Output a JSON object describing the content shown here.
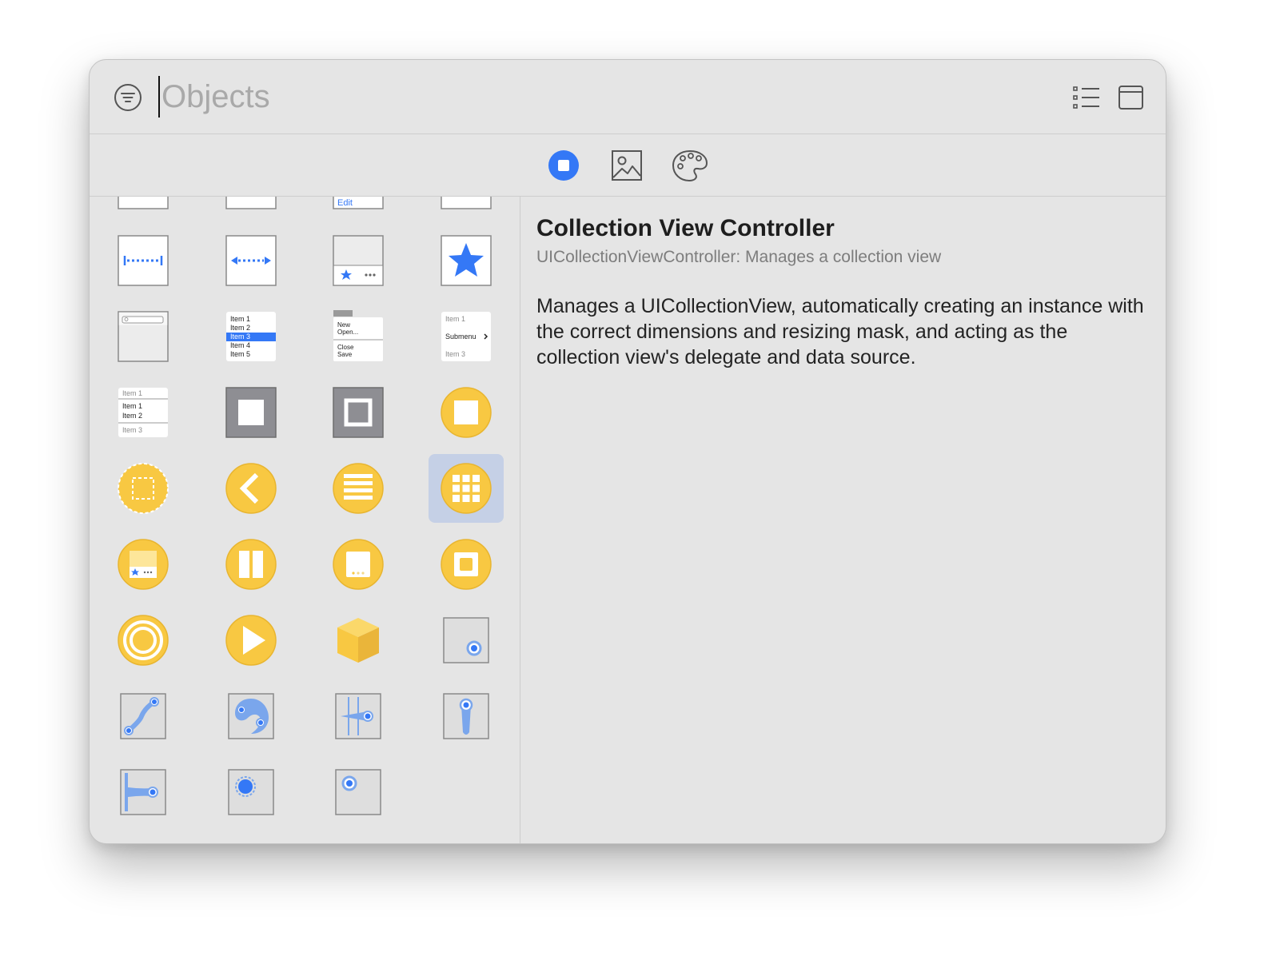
{
  "search": {
    "placeholder": "Objects",
    "value": ""
  },
  "toolbar": {
    "filter_icon": "filter-circle-icon",
    "list_icon": "list-view-icon",
    "panel_icon": "window-panel-icon"
  },
  "segments": [
    {
      "name": "objects",
      "icon": "stop-circle-icon",
      "selected": true
    },
    {
      "name": "images",
      "icon": "photo-icon",
      "selected": false
    },
    {
      "name": "colors",
      "icon": "palette-icon",
      "selected": false
    }
  ],
  "library": {
    "partial_labels": {
      "edit": "Edit"
    },
    "table_view": {
      "items": [
        "Item 1",
        "Item 2",
        "Item 3",
        "Item 4",
        "Item 5"
      ]
    },
    "menu": {
      "items": [
        "New",
        "Open...",
        "Close",
        "Save"
      ]
    },
    "submenu": {
      "item1": "Item 1",
      "submenu": "Submenu",
      "item3": "Item 3"
    },
    "picker": {
      "top": "Item 1",
      "item1": "Item 1",
      "item2": "Item 2",
      "bottom": "Item 3"
    },
    "selected_item": "collection-view-controller"
  },
  "detail": {
    "title": "Collection View Controller",
    "subtitle": "UICollectionViewController: Manages a collection view",
    "description": "Manages a UICollectionView, automatically creating an instance with the correct dimensions and resizing mask, and acting as the collection view's delegate and data source."
  },
  "colors": {
    "accent": "#3478f6",
    "controller_yellow": "#f8c842",
    "selection": "#c5d0e6",
    "window_bg": "#e5e5e5"
  }
}
